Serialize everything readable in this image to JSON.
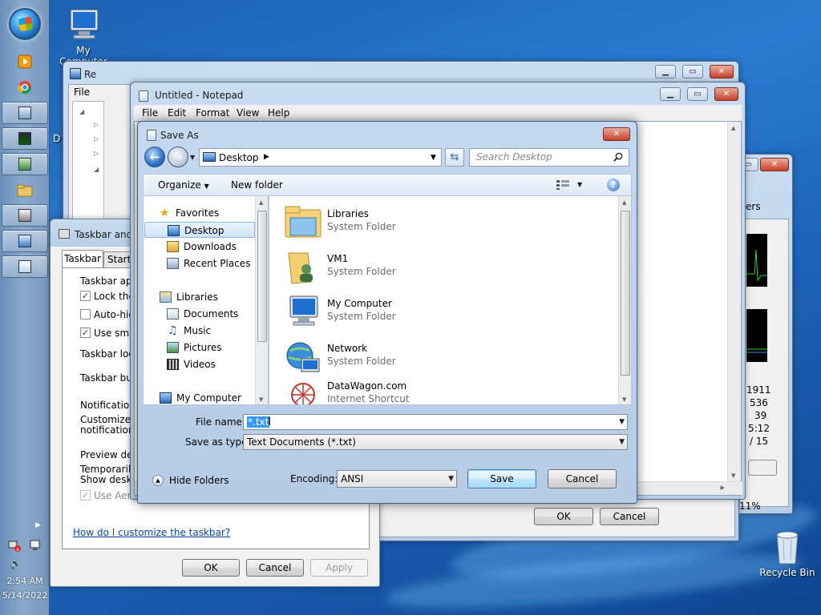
{
  "desktop": {
    "my_computer_label": "My Computer",
    "recycle_bin_label": "Recycle Bin"
  },
  "taskbar": {
    "clock_time": "2:54 AM",
    "clock_date": "5/14/2022",
    "pinned": [
      "media-player-icon",
      "chrome-icon"
    ],
    "buttons": [
      "registry-editor-icon",
      "task-manager-icon",
      "tools-icon",
      "explorer-icon",
      "usb-icon",
      "remote-icon",
      "notepad-icon"
    ]
  },
  "registry_window": {
    "title": "Re",
    "menu_file": "File"
  },
  "taskmgr_window": {
    "tab_partial": "ers",
    "stats": [
      "1911",
      "536",
      "39",
      "5:12",
      "/ 15"
    ],
    "percent": "11%"
  },
  "back_dialog": {
    "ok_label": "OK",
    "cancel_label": "Cancel"
  },
  "taskbar_props": {
    "title": "Taskbar and S",
    "tab_taskbar": "Taskbar",
    "tab_start": "Start M",
    "group_appearance": "Taskbar appe",
    "lock_label": "Lock the t",
    "autohide_label": "Auto-hide",
    "small_label": "Use small",
    "location_label": "Taskbar locat",
    "buttons_label": "Taskbar butt",
    "group_notification": "Notification a",
    "notify_text1": "Customize wh",
    "notify_text2": "notification a",
    "group_preview": "Preview desk",
    "preview_text1": "Temporarily v",
    "preview_text2": "Show desktop",
    "aero_label": "Use Aero",
    "help_link": "How do I customize the taskbar?",
    "ok_label": "OK",
    "cancel_label": "Cancel",
    "apply_label": "Apply"
  },
  "notepad": {
    "title": "Untitled - Notepad",
    "menu": [
      "File",
      "Edit",
      "Format",
      "View",
      "Help"
    ]
  },
  "save_as": {
    "title": "Save As",
    "address": "Desktop",
    "search_placeholder": "Search Desktop",
    "organize_label": "Organize",
    "new_folder_label": "New folder",
    "nav": {
      "favorites": "Favorites",
      "desktop": "Desktop",
      "downloads": "Downloads",
      "recent": "Recent Places",
      "libraries": "Libraries",
      "documents": "Documents",
      "music": "Music",
      "pictures": "Pictures",
      "videos": "Videos",
      "computer": "My Computer"
    },
    "files": [
      {
        "name": "Libraries",
        "type": "System Folder"
      },
      {
        "name": "VM1",
        "type": "System Folder"
      },
      {
        "name": "My Computer",
        "type": "System Folder"
      },
      {
        "name": "Network",
        "type": "System Folder"
      },
      {
        "name": "DataWagon.com",
        "type": "Internet Shortcut"
      }
    ],
    "file_name_label": "File name:",
    "file_name_value": "*.txt",
    "save_type_label": "Save as type:",
    "save_type_value": "Text Documents (*.txt)",
    "hide_folders_label": "Hide Folders",
    "encoding_label": "Encoding:",
    "encoding_value": "ANSI",
    "save_label": "Save",
    "cancel_label": "Cancel"
  }
}
